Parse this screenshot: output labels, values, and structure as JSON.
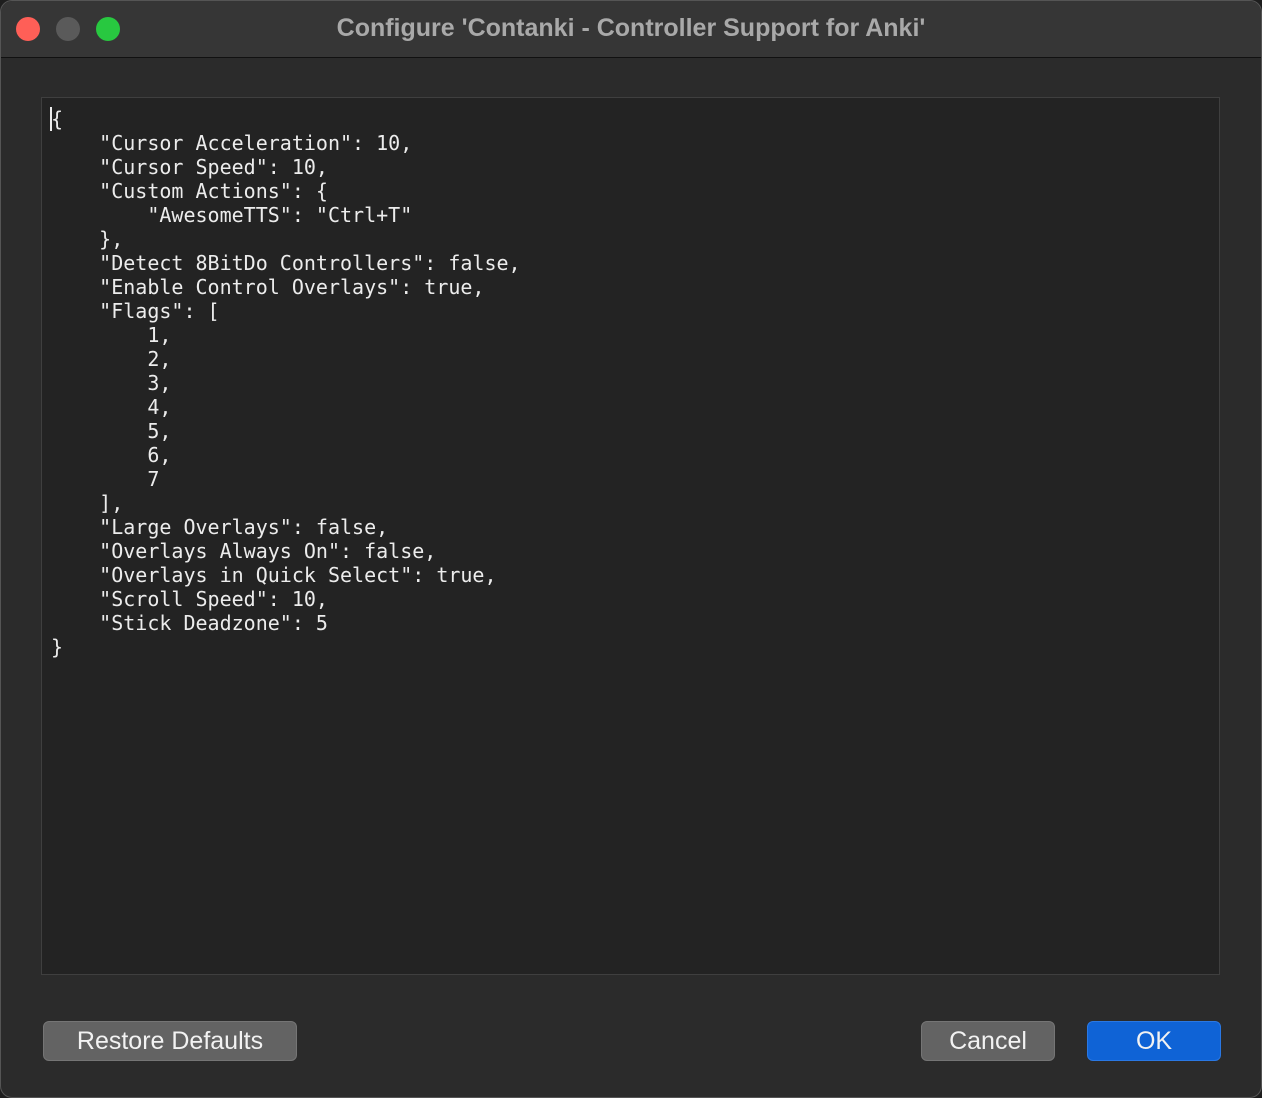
{
  "window": {
    "title": "Configure 'Contanki - Controller Support for Anki'"
  },
  "editor": {
    "content": "{\n    \"Cursor Acceleration\": 10,\n    \"Cursor Speed\": 10,\n    \"Custom Actions\": {\n        \"AwesomeTTS\": \"Ctrl+T\"\n    },\n    \"Detect 8BitDo Controllers\": false,\n    \"Enable Control Overlays\": true,\n    \"Flags\": [\n        1,\n        2,\n        3,\n        4,\n        5,\n        6,\n        7\n    ],\n    \"Large Overlays\": false,\n    \"Overlays Always On\": false,\n    \"Overlays in Quick Select\": true,\n    \"Scroll Speed\": 10,\n    \"Stick Deadzone\": 5\n}"
  },
  "buttons": {
    "restore_defaults": "Restore Defaults",
    "cancel": "Cancel",
    "ok": "OK"
  },
  "colors": {
    "close": "#ff5f57",
    "minimize": "#5a5a5a",
    "maximize": "#28c840",
    "accent": "#0f63d6"
  }
}
